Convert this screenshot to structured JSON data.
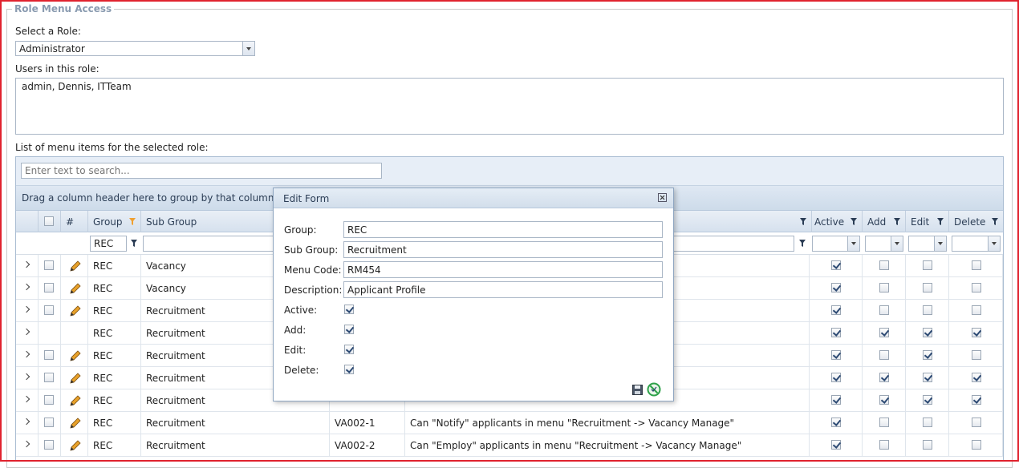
{
  "panel": {
    "legend": "Role Menu Access",
    "select_role_label": "Select a Role:",
    "select_role_value": "Administrator",
    "users_label": "Users in this role:",
    "users_value": "admin, Dennis, ITTeam",
    "list_label": "List of menu items for the selected role:"
  },
  "grid": {
    "search_placeholder": "Enter text to search...",
    "group_panel_text": "Drag a column header here to group by that column",
    "headers": {
      "hash": "#",
      "group": "Group",
      "sub_group": "Sub Group",
      "active": "Active",
      "add": "Add",
      "edit": "Edit",
      "delete": "Delete"
    },
    "filter_group": "REC",
    "rows": [
      {
        "group": "REC",
        "sub_group": "Vacancy",
        "code": "",
        "description": "",
        "editable": true,
        "selectable": true,
        "active": true,
        "add": false,
        "edit": false,
        "delete": false
      },
      {
        "group": "REC",
        "sub_group": "Vacancy",
        "code": "",
        "description": "",
        "editable": true,
        "selectable": true,
        "active": true,
        "add": false,
        "edit": false,
        "delete": false
      },
      {
        "group": "REC",
        "sub_group": "Recruitment",
        "code": "",
        "description": "",
        "editable": true,
        "selectable": true,
        "active": true,
        "add": false,
        "edit": false,
        "delete": false
      },
      {
        "group": "REC",
        "sub_group": "Recruitment",
        "code": "",
        "description": "",
        "editable": false,
        "selectable": false,
        "active": true,
        "add": true,
        "edit": true,
        "delete": true
      },
      {
        "group": "REC",
        "sub_group": "Recruitment",
        "code": "",
        "description": "",
        "editable": true,
        "selectable": true,
        "active": true,
        "add": false,
        "edit": true,
        "delete": false
      },
      {
        "group": "REC",
        "sub_group": "Recruitment",
        "code": "",
        "description": "",
        "editable": true,
        "selectable": true,
        "active": true,
        "add": true,
        "edit": true,
        "delete": true
      },
      {
        "group": "REC",
        "sub_group": "Recruitment",
        "code": "",
        "description": "",
        "editable": true,
        "selectable": true,
        "active": true,
        "add": true,
        "edit": true,
        "delete": true
      },
      {
        "group": "REC",
        "sub_group": "Recruitment",
        "code": "VA002-1",
        "description": "Can \"Notify\" applicants in menu \"Recruitment -> Vacancy Manage\"",
        "editable": true,
        "selectable": true,
        "active": true,
        "add": false,
        "edit": false,
        "delete": false
      },
      {
        "group": "REC",
        "sub_group": "Recruitment",
        "code": "VA002-2",
        "description": "Can \"Employ\" applicants in menu \"Recruitment -> Vacancy Manage\"",
        "editable": true,
        "selectable": true,
        "active": true,
        "add": false,
        "edit": false,
        "delete": false
      }
    ]
  },
  "dialog": {
    "title": "Edit Form",
    "group_label": "Group:",
    "group_value": "REC",
    "sub_group_label": "Sub Group:",
    "sub_group_value": "Recruitment",
    "menu_code_label": "Menu Code:",
    "menu_code_value": "RM454",
    "description_label": "Description:",
    "description_value": "Applicant Profile",
    "active_label": "Active:",
    "add_label": "Add:",
    "edit_label": "Edit:",
    "delete_label": "Delete:",
    "active": true,
    "add": true,
    "edit": true,
    "delete": true
  },
  "icons": {
    "expand": "chevron-right-icon",
    "edit": "pencil-icon",
    "filter": "filter-icon",
    "save": "save-icon",
    "cancel": "cancel-icon",
    "close": "close-icon"
  },
  "colors": {
    "frame_border": "#e0222e",
    "grid_header_bg": "#d6e1ee",
    "sort_indicator": "#f0a030"
  }
}
